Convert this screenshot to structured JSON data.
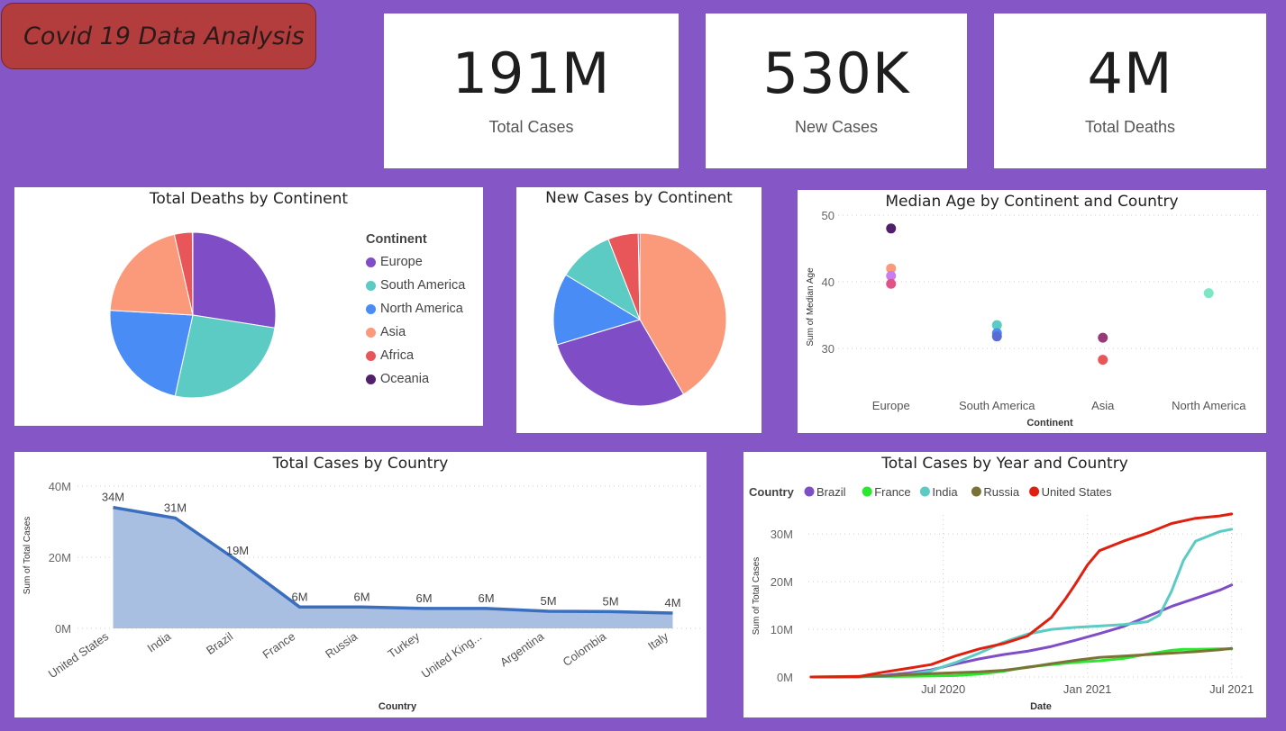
{
  "header": {
    "title": "Covid 19 Data Analysis"
  },
  "kpis": [
    {
      "value": "191M",
      "label": "Total Cases"
    },
    {
      "value": "530K",
      "label": "New Cases"
    },
    {
      "value": "4M",
      "label": "Total Deaths"
    }
  ],
  "colors": {
    "background": "#8556c6",
    "title_badge": "#b33d3d",
    "Europe": "#7f4ec7",
    "South America": "#5ccbc4",
    "North America": "#4a8cf6",
    "Asia": "#fb9a7a",
    "Africa": "#e9565a",
    "Oceania": "#52206a",
    "area_fill": "#a9bfe2",
    "area_line": "#3a6fc0",
    "Brazil": "#7f4ec7",
    "France": "#29e82d",
    "India": "#5ccbc4",
    "Russia": "#7a7236",
    "United States": "#e0200f"
  },
  "legend_continent": {
    "title": "Continent",
    "items": [
      "Europe",
      "South America",
      "North America",
      "Asia",
      "Africa",
      "Oceania"
    ]
  },
  "chart_data": [
    {
      "id": "deaths_pie",
      "type": "pie",
      "title": "Total Deaths by Continent",
      "categories": [
        "Europe",
        "South America",
        "North America",
        "Asia",
        "Africa",
        "Oceania"
      ],
      "values": [
        27.5,
        26.0,
        22.5,
        20.5,
        3.5,
        0.1
      ]
    },
    {
      "id": "newcases_pie",
      "type": "pie",
      "title": "New Cases by Continent",
      "categories": [
        "Asia",
        "Europe",
        "North America",
        "South America",
        "Africa",
        "Oceania"
      ],
      "values": [
        42.0,
        29.0,
        13.5,
        10.5,
        5.7,
        0.3
      ]
    },
    {
      "id": "median_age",
      "type": "scatter",
      "title": "Median Age by Continent and Country",
      "xlabel": "Continent",
      "ylabel": "Sum of Median Age",
      "categories": [
        "Europe",
        "South America",
        "Asia",
        "North America"
      ],
      "ylim": [
        25,
        50
      ],
      "yticks": [
        30,
        40,
        50
      ],
      "points": [
        {
          "x": "Europe",
          "y": 48.0,
          "color": "#52206a"
        },
        {
          "x": "Europe",
          "y": 42.0,
          "color": "#fb9a7a"
        },
        {
          "x": "Europe",
          "y": 40.9,
          "color": "#c97ef0"
        },
        {
          "x": "Europe",
          "y": 39.7,
          "color": "#e1528b"
        },
        {
          "x": "South America",
          "y": 33.5,
          "color": "#5ccbc4"
        },
        {
          "x": "South America",
          "y": 32.3,
          "color": "#4a8cf6"
        },
        {
          "x": "South America",
          "y": 31.8,
          "color": "#5a6bd6"
        },
        {
          "x": "Asia",
          "y": 31.6,
          "color": "#953b78"
        },
        {
          "x": "Asia",
          "y": 28.3,
          "color": "#e9565a"
        },
        {
          "x": "North America",
          "y": 38.3,
          "color": "#7ee6c5"
        }
      ]
    },
    {
      "id": "cases_by_country",
      "type": "area",
      "title": "Total Cases by Country",
      "xlabel": "Country",
      "ylabel": "Sum of Total Cases",
      "categories": [
        "United States",
        "India",
        "Brazil",
        "France",
        "Russia",
        "Turkey",
        "United King...",
        "Argentina",
        "Colombia",
        "Italy"
      ],
      "values": [
        34,
        31,
        19,
        6,
        6,
        5.6,
        5.6,
        4.8,
        4.7,
        4.3
      ],
      "labels": [
        "34M",
        "31M",
        "19M",
        "6M",
        "6M",
        "6M",
        "6M",
        "5M",
        "5M",
        "4M"
      ],
      "ylim": [
        0,
        42
      ],
      "yticks": [
        {
          "v": 0,
          "label": "0M"
        },
        {
          "v": 20,
          "label": "20M"
        },
        {
          "v": 40,
          "label": "40M"
        }
      ]
    },
    {
      "id": "cases_by_year",
      "type": "line",
      "title": "Total Cases by Year and Country",
      "xlabel": "Date",
      "ylabel": "Sum of Total Cases",
      "legend_title": "Country",
      "x_ticks": [
        {
          "m": 5.5,
          "label": "Jul 2020"
        },
        {
          "m": 11.5,
          "label": "Jan 2021"
        },
        {
          "m": 17.5,
          "label": "Jul 2021"
        }
      ],
      "xlim": [
        0,
        18
      ],
      "ylim": [
        0,
        34
      ],
      "yticks": [
        {
          "v": 0,
          "label": "0M"
        },
        {
          "v": 10,
          "label": "10M"
        },
        {
          "v": 20,
          "label": "20M"
        },
        {
          "v": 30,
          "label": "30M"
        }
      ],
      "series": [
        {
          "name": "Brazil",
          "points": [
            [
              0,
              0
            ],
            [
              2,
              0
            ],
            [
              3,
              0.3
            ],
            [
              4,
              0.8
            ],
            [
              5,
              1.5
            ],
            [
              6,
              2.7
            ],
            [
              7,
              3.8
            ],
            [
              8,
              4.7
            ],
            [
              9,
              5.4
            ],
            [
              10,
              6.4
            ],
            [
              11,
              7.7
            ],
            [
              12,
              9.1
            ],
            [
              13,
              10.6
            ],
            [
              14,
              12.7
            ],
            [
              15,
              14.8
            ],
            [
              16,
              16.5
            ],
            [
              17,
              18.2
            ],
            [
              17.5,
              19.3
            ]
          ]
        },
        {
          "name": "France",
          "points": [
            [
              0,
              0
            ],
            [
              3,
              0.1
            ],
            [
              5,
              0.2
            ],
            [
              6,
              0.3
            ],
            [
              7,
              0.6
            ],
            [
              8,
              1.2
            ],
            [
              9,
              2.1
            ],
            [
              10,
              2.6
            ],
            [
              11,
              3.1
            ],
            [
              12,
              3.4
            ],
            [
              13,
              3.9
            ],
            [
              14,
              4.8
            ],
            [
              15,
              5.6
            ],
            [
              15.5,
              5.8
            ],
            [
              16,
              5.8
            ],
            [
              17,
              5.9
            ],
            [
              17.5,
              5.9
            ]
          ]
        },
        {
          "name": "India",
          "points": [
            [
              0,
              0
            ],
            [
              3,
              0.1
            ],
            [
              4,
              0.5
            ],
            [
              5,
              1.3
            ],
            [
              6,
              3.0
            ],
            [
              7,
              5.0
            ],
            [
              8,
              7.3
            ],
            [
              9,
              9.0
            ],
            [
              10,
              10.0
            ],
            [
              11,
              10.4
            ],
            [
              12,
              10.7
            ],
            [
              13,
              11.0
            ],
            [
              14,
              11.6
            ],
            [
              14.5,
              13.0
            ],
            [
              15,
              18.0
            ],
            [
              15.5,
              24.5
            ],
            [
              16,
              28.5
            ],
            [
              17,
              30.5
            ],
            [
              17.5,
              31.0
            ]
          ]
        },
        {
          "name": "Russia",
          "points": [
            [
              0,
              0
            ],
            [
              3,
              0.2
            ],
            [
              4,
              0.5
            ],
            [
              5,
              0.7
            ],
            [
              6,
              0.9
            ],
            [
              7,
              1.1
            ],
            [
              8,
              1.4
            ],
            [
              9,
              2.0
            ],
            [
              10,
              2.8
            ],
            [
              11,
              3.5
            ],
            [
              12,
              4.1
            ],
            [
              13,
              4.4
            ],
            [
              14,
              4.7
            ],
            [
              15,
              5.0
            ],
            [
              16,
              5.3
            ],
            [
              17,
              5.7
            ],
            [
              17.5,
              6.0
            ]
          ]
        },
        {
          "name": "United States",
          "points": [
            [
              0,
              0
            ],
            [
              1,
              0
            ],
            [
              2,
              0.1
            ],
            [
              3,
              1.0
            ],
            [
              4,
              1.8
            ],
            [
              5,
              2.6
            ],
            [
              6,
              4.4
            ],
            [
              7,
              5.9
            ],
            [
              8,
              7.0
            ],
            [
              9,
              8.6
            ],
            [
              10,
              12.5
            ],
            [
              10.6,
              16.5
            ],
            [
              11,
              19.5
            ],
            [
              11.5,
              23.5
            ],
            [
              12,
              26.5
            ],
            [
              13,
              28.5
            ],
            [
              14,
              30.2
            ],
            [
              15,
              32.2
            ],
            [
              16,
              33.3
            ],
            [
              17,
              33.8
            ],
            [
              17.5,
              34.2
            ]
          ]
        }
      ]
    }
  ]
}
